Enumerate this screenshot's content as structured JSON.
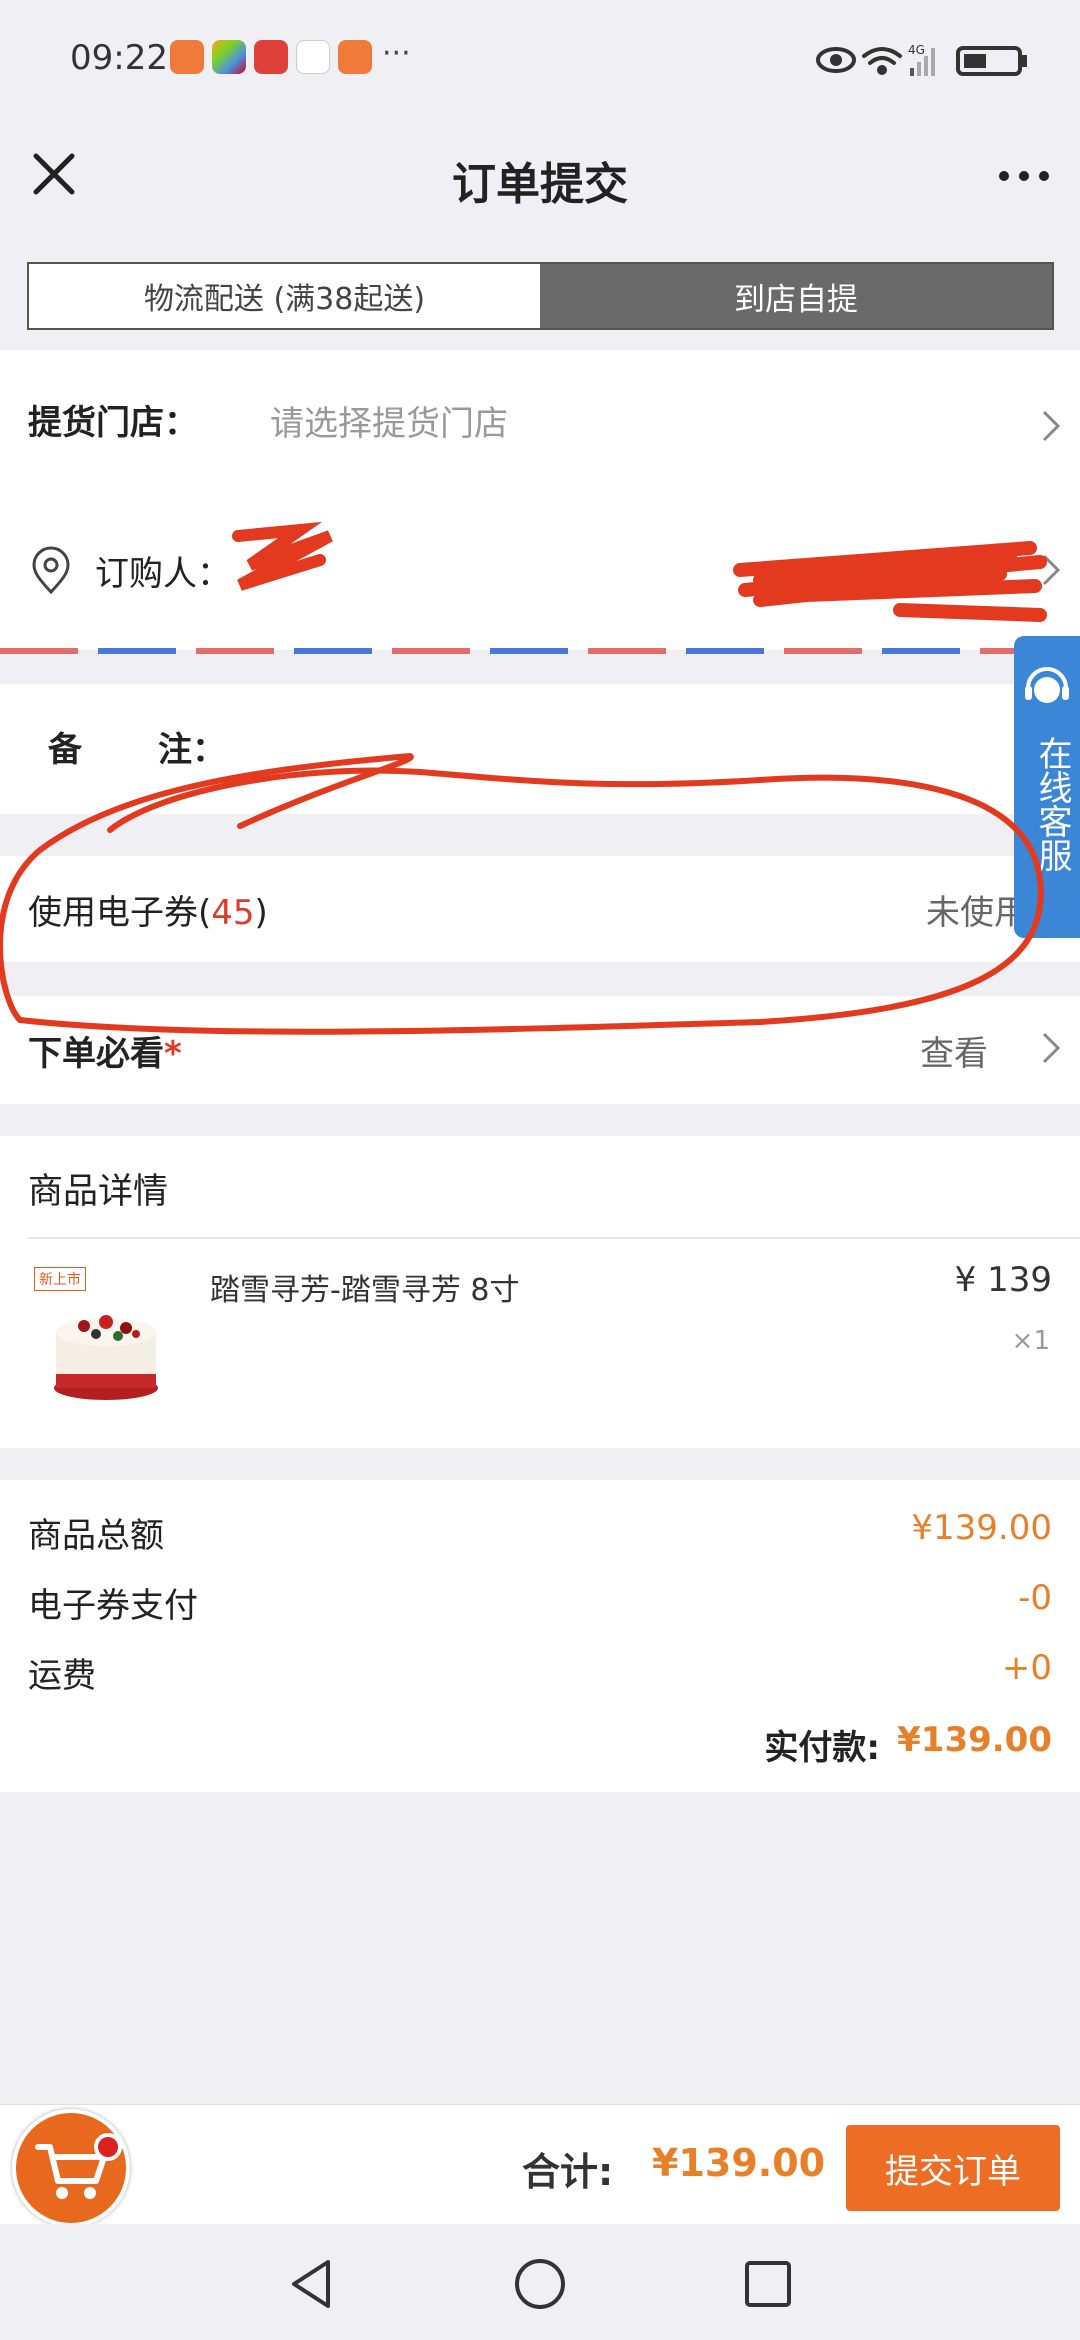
{
  "status_bar": {
    "time": "09:22",
    "more": "···",
    "network": "4G"
  },
  "header": {
    "title": "订单提交"
  },
  "delivery_toggle": {
    "tabs": [
      {
        "label": "物流配送 (满38起送)",
        "selected": false
      },
      {
        "label": "到店自提",
        "selected": true
      }
    ]
  },
  "pickup_store": {
    "label": "提货门店：",
    "placeholder": "请选择提货门店"
  },
  "buyer": {
    "label": "订购人："
  },
  "remark": {
    "label": "备",
    "label2": "注："
  },
  "voucher": {
    "label_prefix": "使用电子券(",
    "count": "45",
    "label_suffix": ")",
    "status": "未使用"
  },
  "must_read": {
    "label": "下单必看",
    "required_mark": "*",
    "action": "查看"
  },
  "product_details": {
    "title": "商品详情",
    "items": [
      {
        "badge": "新上市",
        "name": "踏雪寻芳-踏雪寻芳 8寸",
        "price": "¥ 139",
        "qty": "×1"
      }
    ]
  },
  "summary": {
    "rows": [
      {
        "label": "商品总额",
        "value": "¥139.00"
      },
      {
        "label": "电子券支付",
        "value": "-0"
      },
      {
        "label": "运费",
        "value": "+0"
      }
    ],
    "paid_label": "实付款:",
    "paid_value": "¥139.00"
  },
  "bottom_bar": {
    "total_label": "合计:",
    "total_value": "¥139.00",
    "submit_label": "提交订单"
  },
  "floating_service": {
    "label": "在线客服"
  },
  "colors": {
    "accent": "#ee6d24",
    "price": "#e8802a",
    "annotation": "#e2391f",
    "service": "#3c86d8"
  }
}
